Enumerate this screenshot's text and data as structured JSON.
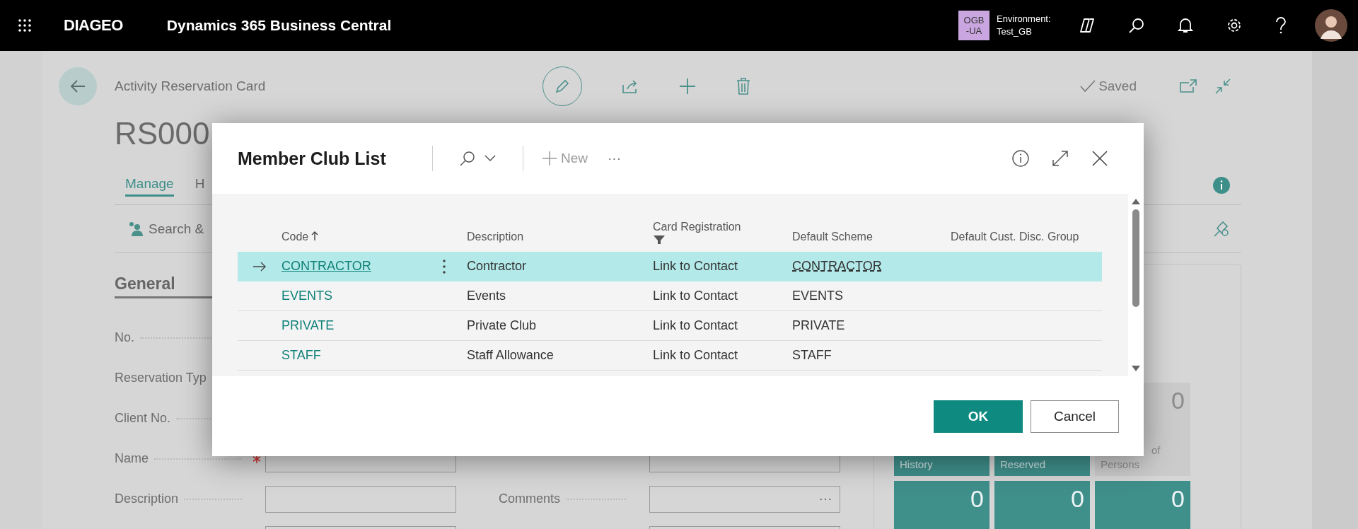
{
  "top_bar": {
    "company": "DIAGEO",
    "app_title": "Dynamics 365 Business Central",
    "environment_badge": [
      "OGB",
      "-UA"
    ],
    "environment_label": "Environment:",
    "environment_name": "Test_GB"
  },
  "page": {
    "caption": "Activity Reservation Card",
    "title": "RS000",
    "saved": "Saved",
    "tabs": [
      {
        "label": "Manage",
        "selected": true
      },
      {
        "label": "H",
        "selected": false
      }
    ],
    "action": "Search &",
    "section": "General",
    "left_fields": [
      {
        "label": "No.",
        "kind": "label"
      },
      {
        "label": "Reservation Typ",
        "kind": "label"
      },
      {
        "label": "Client No.",
        "kind": "label"
      },
      {
        "label": "Name",
        "kind": "field",
        "required": true
      },
      {
        "label": "Description",
        "kind": "field",
        "required": false
      },
      {
        "kind": "field"
      }
    ],
    "right_fields": [
      {
        "kind": "field"
      },
      {
        "label": "Comments",
        "kind": "field",
        "assist": "···"
      },
      {
        "kind": "field"
      }
    ],
    "tiles": [
      {
        "label_lines": [
          "History"
        ],
        "kind": "accent"
      },
      {
        "label_lines": [
          "Reserved"
        ],
        "kind": "accent"
      },
      {
        "value": "0",
        "label_lines": [
          "of",
          "Persons"
        ],
        "kind": "plain"
      },
      {
        "value": "0",
        "kind": "accent"
      },
      {
        "value": "0",
        "kind": "accent"
      },
      {
        "value": "0",
        "kind": "accent"
      }
    ]
  },
  "dialog": {
    "title": "Member Club List",
    "new_action": "New",
    "more": "···",
    "columns": [
      {
        "label": "Code",
        "sorted": true,
        "filtered": false
      },
      {
        "label": "Description",
        "sorted": false,
        "filtered": false
      },
      {
        "label": "Card Registration",
        "sorted": false,
        "filtered": true
      },
      {
        "label": "Default Scheme",
        "sorted": false,
        "filtered": false
      },
      {
        "label": "Default Cust. Disc. Group",
        "sorted": false,
        "filtered": false
      }
    ],
    "rows": [
      {
        "code": "CONTRACTOR",
        "description": "Contractor",
        "card_registration": "Link to Contact",
        "default_scheme": "CONTRACTOR",
        "selected": true
      },
      {
        "code": "EVENTS",
        "description": "Events",
        "card_registration": "Link to Contact",
        "default_scheme": "EVENTS",
        "selected": false
      },
      {
        "code": "PRIVATE",
        "description": "Private Club",
        "card_registration": "Link to Contact",
        "default_scheme": "PRIVATE",
        "selected": false
      },
      {
        "code": "STAFF",
        "description": "Staff Allowance",
        "card_registration": "Link to Contact",
        "default_scheme": "STAFF",
        "selected": false
      }
    ],
    "buttons": [
      {
        "label": "OK",
        "kind": "primary"
      },
      {
        "label": "Cancel",
        "kind": "secondary"
      }
    ]
  }
}
